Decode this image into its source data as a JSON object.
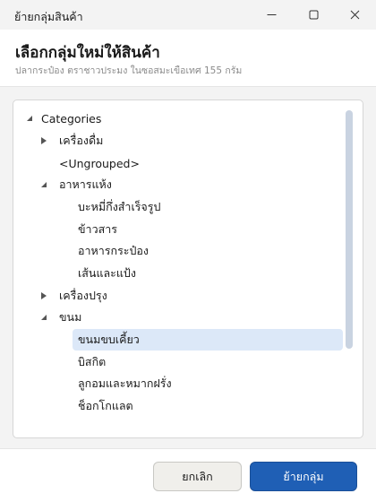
{
  "window": {
    "title": "ย้ายกลุ่มสินค้า",
    "controls": [
      "minimize-icon",
      "maximize-icon",
      "close-icon"
    ]
  },
  "header": {
    "title": "เลือกกลุ่มใหม่ให้สินค้า",
    "subtitle": "ปลากระป๋อง ตราชาวประมง ในซอสมะเขือเทศ 155 กรัม"
  },
  "tree": {
    "root": "Categories",
    "items": [
      {
        "label": "เครื่องดื่ม",
        "expandable": true,
        "expanded": false
      },
      {
        "label": "<Ungrouped>",
        "expandable": false
      },
      {
        "label": "อาหารแห้ง",
        "expandable": true,
        "expanded": true,
        "children": [
          "บะหมี่กึ่งสำเร็จรูป",
          "ข้าวสาร",
          "อาหารกระป๋อง",
          "เส้นและแป้ง"
        ]
      },
      {
        "label": "เครื่องปรุง",
        "expandable": true,
        "expanded": false
      },
      {
        "label": "ขนม",
        "expandable": true,
        "expanded": true,
        "children": [
          "ขนมขบเคี้ยว",
          "บิสกิต",
          "ลูกอมและหมากฝรั่ง",
          "ช็อกโกแลต"
        ]
      }
    ],
    "selected": "ขนมขบเคี้ยว"
  },
  "footer": {
    "cancel_label": "ยกเลิก",
    "move_label": "ย้ายกลุ่ม"
  },
  "colors": {
    "accent": "#1f5fb5",
    "selection": "#dce8f8",
    "scrollbar": "#c9d3e1"
  }
}
